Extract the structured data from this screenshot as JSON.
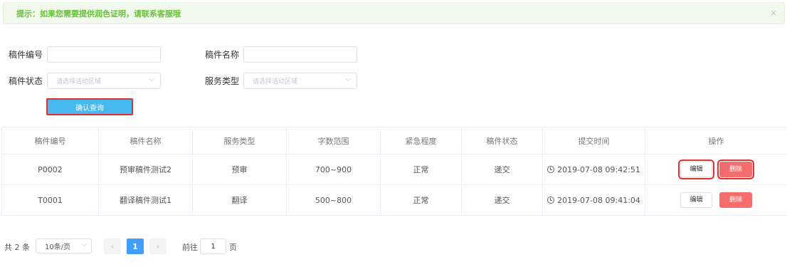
{
  "alert": {
    "text": "提示：如果您需要提供润色证明，请联系客服哦",
    "close_icon": "×"
  },
  "form": {
    "manuscript_no_label": "稿件编号",
    "manuscript_no_value": "",
    "manuscript_name_label": "稿件名称",
    "manuscript_name_value": "",
    "status_label": "稿件状态",
    "status_placeholder": "请选择活动区域",
    "service_label": "服务类型",
    "service_placeholder": "请选择活动区域",
    "chevron": "⌵",
    "query_button": "确认查询"
  },
  "table": {
    "headers": [
      "稿件编号",
      "稿件名称",
      "服务类型",
      "字数范围",
      "紧急程度",
      "稿件状态",
      "提交时间",
      "操作"
    ],
    "rows": [
      {
        "no": "P0002",
        "name": "预审稿件测试2",
        "service": "预审",
        "words": "700~900",
        "urgency": "正常",
        "status": "递交",
        "time": "2019-07-08 09:42:51"
      },
      {
        "no": "T0001",
        "name": "翻译稿件测试1",
        "service": "翻译",
        "words": "500~800",
        "urgency": "正常",
        "status": "递交",
        "time": "2019-07-08 09:41:04"
      }
    ],
    "edit_label": "编辑",
    "delete_label": "删除"
  },
  "pager": {
    "total": "共 2 条",
    "page_size": "10条/页",
    "prev": "‹",
    "current": "1",
    "next": "›",
    "goto_prefix": "前往",
    "goto_value": "1",
    "goto_suffix": "页"
  },
  "colors": {
    "primary": "#409eff",
    "danger": "#f56c6c",
    "success": "#67c23a",
    "highlight": "#e03030"
  }
}
